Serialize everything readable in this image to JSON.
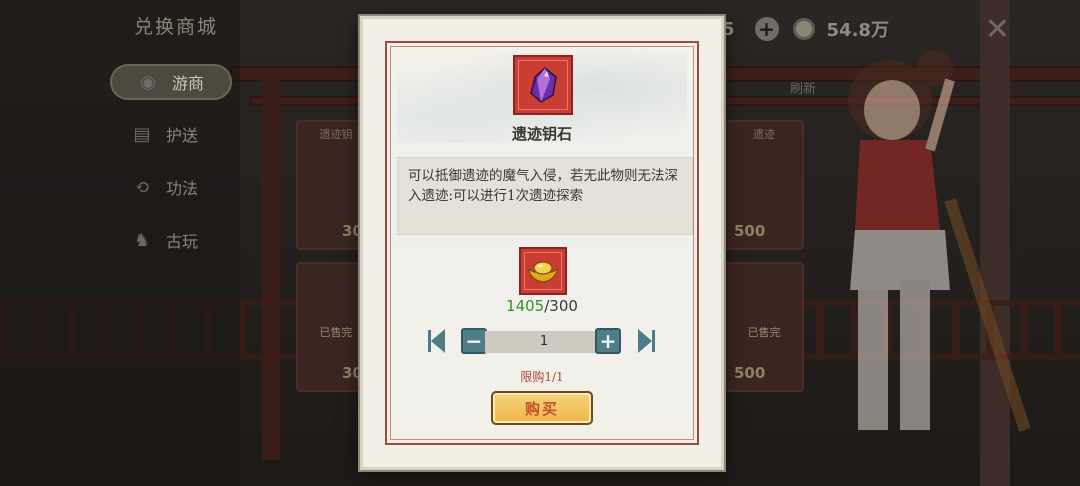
{
  "background": {
    "shop_title": "兑换商城",
    "nav": [
      {
        "label": "游商",
        "icon": "merchant-icon",
        "active": true
      },
      {
        "label": "护送",
        "icon": "cart-icon",
        "active": false
      },
      {
        "label": "功法",
        "icon": "technique-icon",
        "active": false
      },
      {
        "label": "古玩",
        "icon": "antique-icon",
        "active": false
      }
    ],
    "currency": {
      "gold": "54.8万",
      "partial_value": "5"
    },
    "refresh_label": "刷新",
    "card_labels": [
      "遗迹钥",
      "遗迹"
    ],
    "card_prices": [
      "30",
      "500",
      "30",
      "500"
    ],
    "card_badges": [
      "已售完",
      "已售完"
    ]
  },
  "modal": {
    "item_name": "遗迹钥石",
    "item_icon": "crystal-key-icon",
    "description": "可以抵御遗迹的魔气入侵，若无此物则无法深入遗迹:可以进行1次遗迹探索",
    "cost_icon": "gold-ingot-icon",
    "owned": "1405",
    "price_sep": "/",
    "price": "300",
    "quantity": "1",
    "limit_text": "限购1/1",
    "buy_label": "购买"
  },
  "colors": {
    "accent_red": "#c93d32",
    "stepper_teal": "#4e7f89",
    "owned_green": "#3f8a2d",
    "buy_gold": "#efb64a"
  }
}
